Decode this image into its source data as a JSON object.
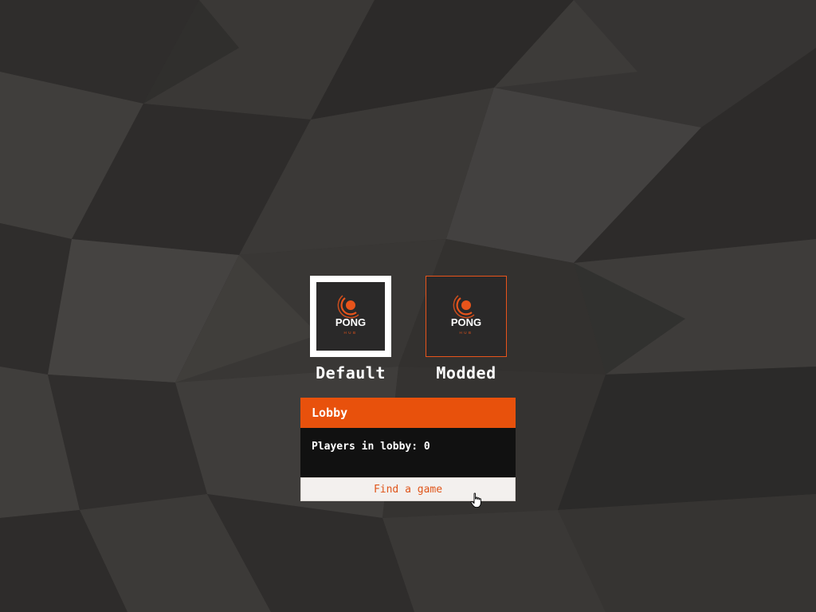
{
  "modes": [
    {
      "label": "Default",
      "logo_text": "PONG",
      "logo_subtext": "HUB",
      "selected": true
    },
    {
      "label": "Modded",
      "logo_text": "PONG",
      "logo_subtext": "HUB",
      "selected": false
    }
  ],
  "lobby": {
    "title": "Lobby",
    "players_text": "Players in lobby: 0",
    "find_button_label": "Find a game"
  },
  "colors": {
    "accent": "#e8510c",
    "background": "#363432",
    "panel_dark": "#111111",
    "button_bg": "#f3f0ee"
  },
  "icons": {
    "logo": "pong-hub-logo-icon",
    "cursor": "hand-pointer-cursor-icon"
  }
}
